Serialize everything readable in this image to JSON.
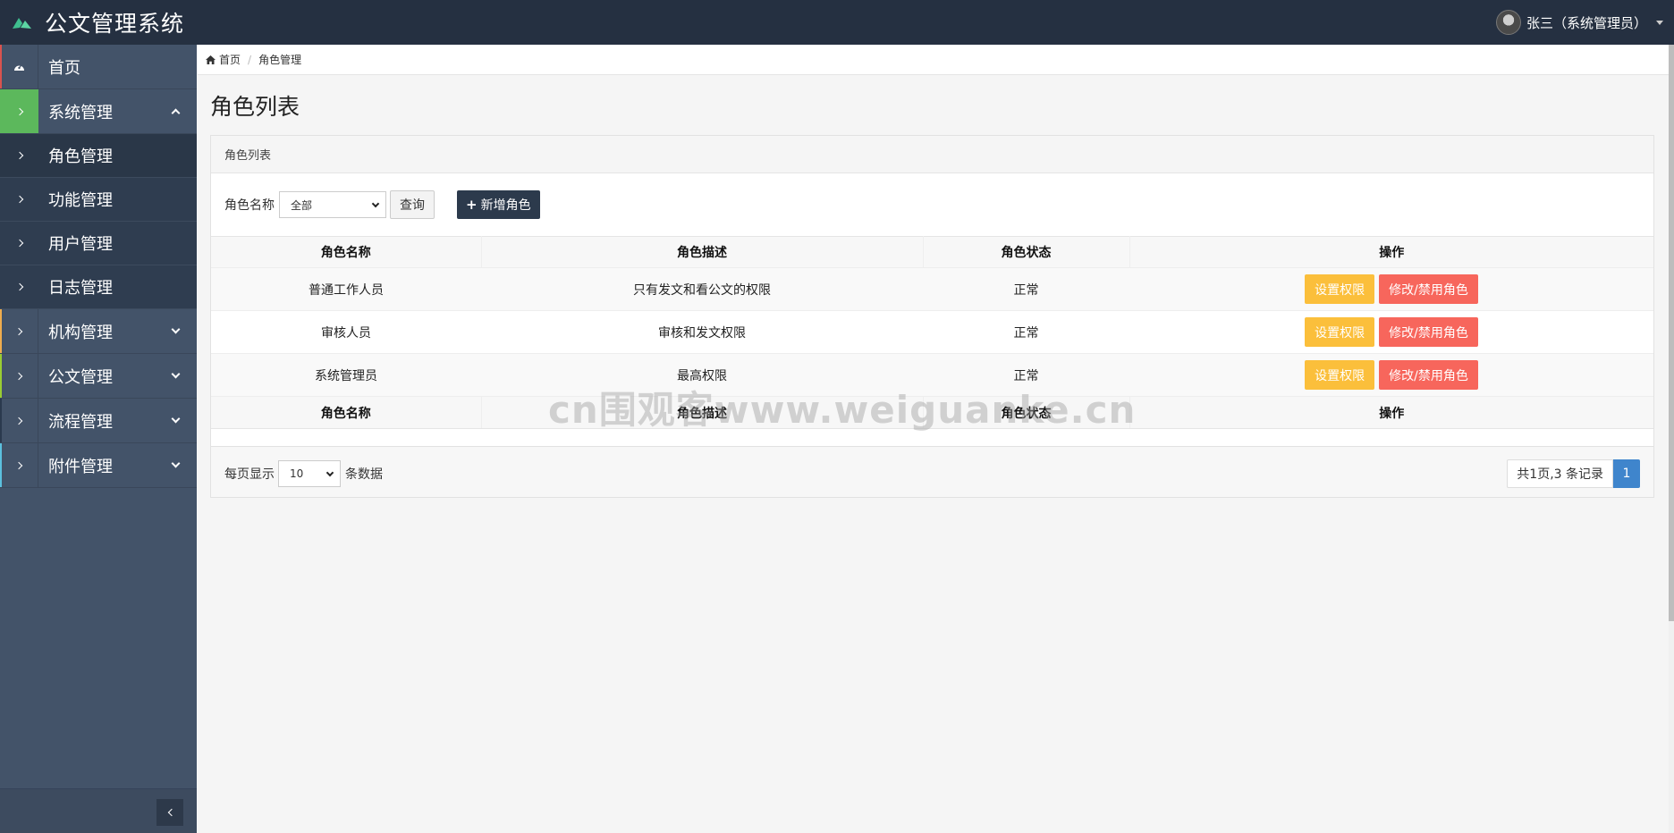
{
  "app": {
    "title": "公文管理系统"
  },
  "user": {
    "display": "张三（系统管理员）"
  },
  "sidebar": {
    "items": [
      {
        "label": "首页"
      },
      {
        "label": "系统管理"
      },
      {
        "label": "机构管理"
      },
      {
        "label": "公文管理"
      },
      {
        "label": "流程管理"
      },
      {
        "label": "附件管理"
      }
    ],
    "submenu": [
      {
        "label": "角色管理"
      },
      {
        "label": "功能管理"
      },
      {
        "label": "用户管理"
      },
      {
        "label": "日志管理"
      }
    ]
  },
  "breadcrumb": {
    "home": "首页",
    "current": "角色管理"
  },
  "page": {
    "title": "角色列表"
  },
  "panel": {
    "heading": "角色列表",
    "filter": {
      "label": "角色名称",
      "selected": "全部",
      "query_button": "查询",
      "add_button": "新增角色"
    }
  },
  "table": {
    "columns": [
      "角色名称",
      "角色描述",
      "角色状态",
      "操作"
    ],
    "rows": [
      {
        "name": "普通工作人员",
        "desc": "只有发文和看公文的权限",
        "status": "正常"
      },
      {
        "name": "审核人员",
        "desc": "审核和发文权限",
        "status": "正常"
      },
      {
        "name": "系统管理员",
        "desc": "最高权限",
        "status": "正常"
      }
    ],
    "action_set_perm": "设置权限",
    "action_edit": "修改/禁用角色"
  },
  "pagination": {
    "per_page_prefix": "每页显示",
    "per_page_value": "10",
    "per_page_suffix": "条数据",
    "summary": "共1页,3 条记录",
    "current_page": "1"
  },
  "watermark": "cn围观客www.weiguanke.cn",
  "colors": {
    "topbar": "#253041",
    "sidebar": "#435369",
    "warning": "#fbbf3b",
    "danger": "#f7665c",
    "primary": "#3f85cc",
    "success": "#5cb85c"
  }
}
